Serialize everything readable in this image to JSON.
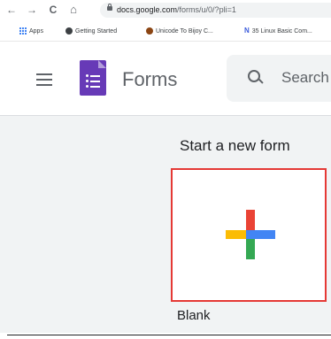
{
  "browser": {
    "url_host": "docs.google.com",
    "url_path": "/forms/u/0/?pli=1",
    "nav": {
      "back": "←",
      "forward": "→",
      "reload": "C",
      "home": "⌂"
    }
  },
  "bookmarks": [
    {
      "label": "Apps",
      "icon": "apps-grid-icon"
    },
    {
      "label": "Getting Started",
      "icon": "globe-icon"
    },
    {
      "label": "Unicode To Bijoy C...",
      "icon": "bookmark-dot-icon"
    },
    {
      "label": "35 Linux Basic Com...",
      "icon": "n-logo-icon"
    }
  ],
  "header": {
    "app_name": "Forms",
    "search_placeholder": "Search"
  },
  "gallery": {
    "section_title": "Start a new form",
    "blank_label": "Blank",
    "highlight_color": "#e53935"
  },
  "colors": {
    "forms_purple": "#673ab7",
    "gallery_bg": "#f1f3f4",
    "plus_red": "#ea4335",
    "plus_blue": "#4285f4",
    "plus_green": "#34a853",
    "plus_yellow": "#fbbc04"
  }
}
